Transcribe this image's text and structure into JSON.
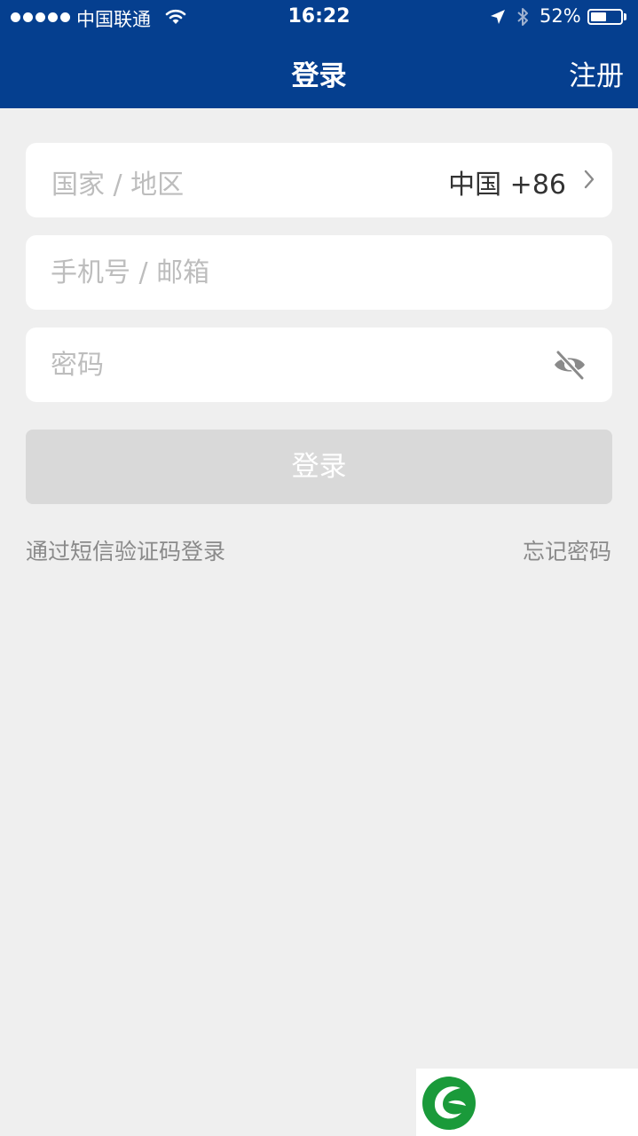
{
  "status_bar": {
    "carrier": "中国联通",
    "time": "16:22",
    "battery_percent": "52%",
    "battery_level": 0.52,
    "signal_bars": 5,
    "icons": [
      "wifi-icon",
      "location-arrow-icon",
      "bluetooth-icon",
      "battery-icon"
    ]
  },
  "nav": {
    "title": "登录",
    "register_label": "注册"
  },
  "form": {
    "region": {
      "label": "国家 / 地区",
      "value": "中国 +86"
    },
    "account": {
      "placeholder": "手机号 / 邮箱",
      "value": ""
    },
    "password": {
      "placeholder": "密码",
      "value": ""
    },
    "login_label": "登录"
  },
  "links": {
    "sms_login": "通过短信验证码登录",
    "forgot_password": "忘记密码"
  },
  "colors": {
    "header_bg": "#053f8f",
    "page_bg": "#efefef",
    "button_disabled": "#d9d9d9",
    "watermark_green": "#1a9a3a"
  }
}
